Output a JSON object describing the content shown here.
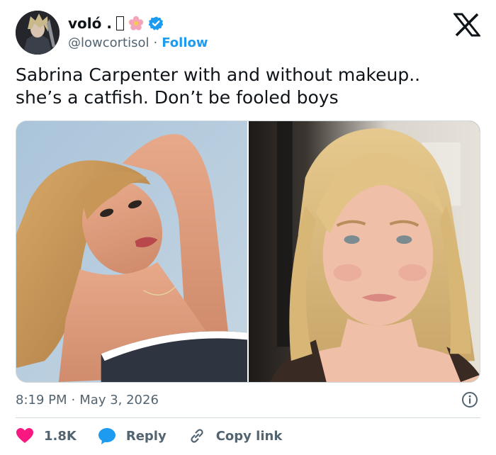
{
  "author": {
    "display_name": "voló .",
    "emoji_box": "▯",
    "handle": "@lowcortisol",
    "separator": "·",
    "follow_label": "Follow"
  },
  "tweet": {
    "lines": [
      "Sabrina Carpenter with and without makeup..",
      "she’s a catfish. Don’t be fooled boys"
    ],
    "time": "8:19 PM",
    "date": "May 3, 2026",
    "meta_separator": "·"
  },
  "actions": {
    "like_count": "1.8K",
    "reply_label": "Reply",
    "copy_label": "Copy link"
  },
  "icons": {
    "platform": "x-logo-icon",
    "verified": "verified-badge-icon",
    "like": "heart-icon",
    "reply": "speech-bubble-icon",
    "copy": "link-icon",
    "info": "info-icon"
  },
  "colors": {
    "accent": "#1d9bf0",
    "like": "#f91880",
    "text": "#0f1419",
    "muted": "#536471",
    "border": "#cfd9de"
  }
}
